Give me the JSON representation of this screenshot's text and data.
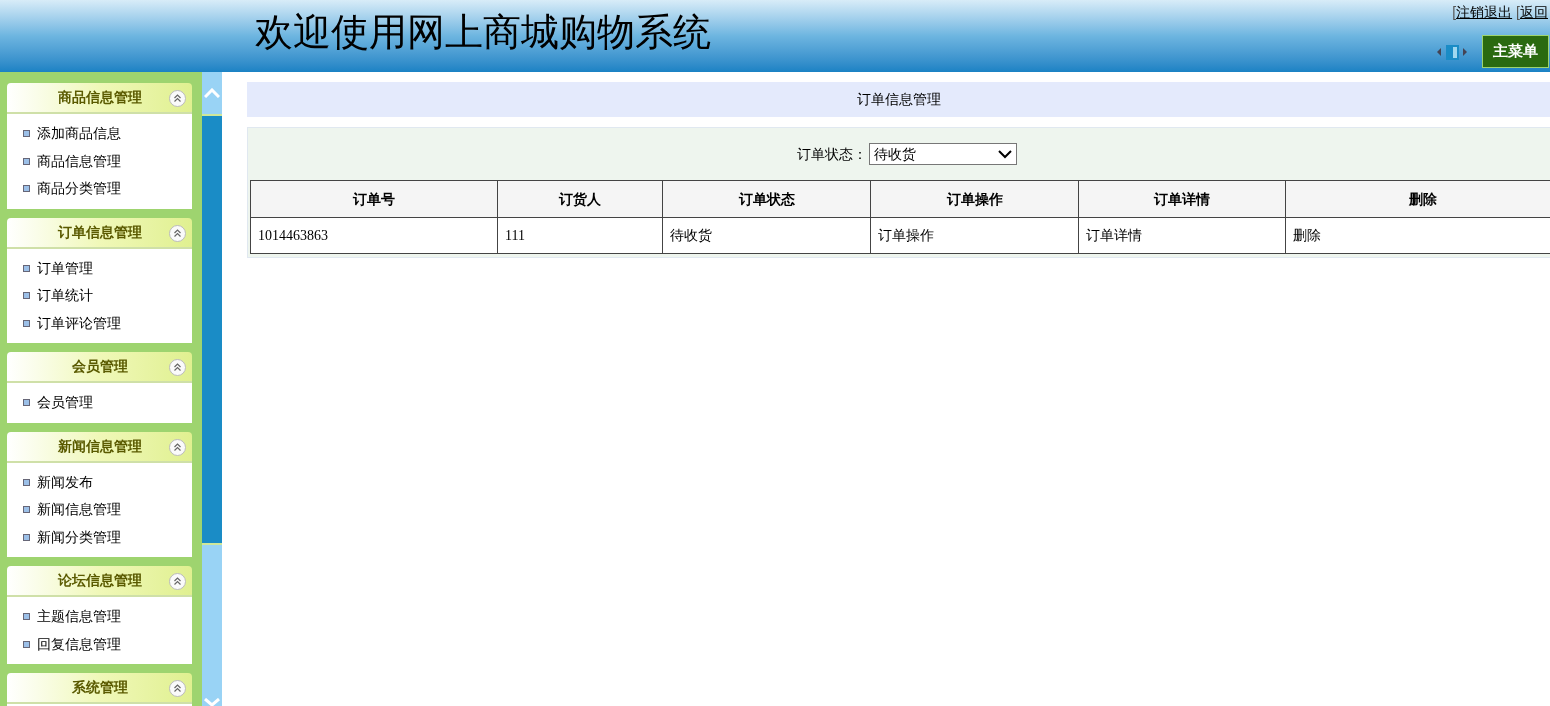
{
  "header": {
    "title": "欢迎使用网上商城购物系统",
    "links": [
      {
        "bracket": "[",
        "label": "注销退出"
      },
      {
        "bracket": "[",
        "label": "返回"
      }
    ],
    "menu_button": "主菜单"
  },
  "sidebar": {
    "groups": [
      {
        "title": "商品信息管理",
        "expanded": true,
        "items": [
          "添加商品信息",
          "商品信息管理",
          "商品分类管理"
        ]
      },
      {
        "title": "订单信息管理",
        "expanded": true,
        "items": [
          "订单管理",
          "订单统计",
          "订单评论管理"
        ]
      },
      {
        "title": "会员管理",
        "expanded": true,
        "items": [
          "会员管理"
        ]
      },
      {
        "title": "新闻信息管理",
        "expanded": true,
        "items": [
          "新闻发布",
          "新闻信息管理",
          "新闻分类管理"
        ]
      },
      {
        "title": "论坛信息管理",
        "expanded": true,
        "items": [
          "主题信息管理",
          "回复信息管理"
        ]
      },
      {
        "title": "系统管理",
        "expanded": true
      }
    ]
  },
  "page_title": "订单信息管理",
  "filter": {
    "label": "订单状态：",
    "value": "待收货"
  },
  "table": {
    "columns": [
      "订单号",
      "订货人",
      "订单状态",
      "订单操作",
      "订单详情",
      "删除"
    ],
    "rows": [
      [
        "1014463863",
        "111",
        "待收货",
        "订单操作",
        "订单详情",
        "删除"
      ]
    ]
  }
}
